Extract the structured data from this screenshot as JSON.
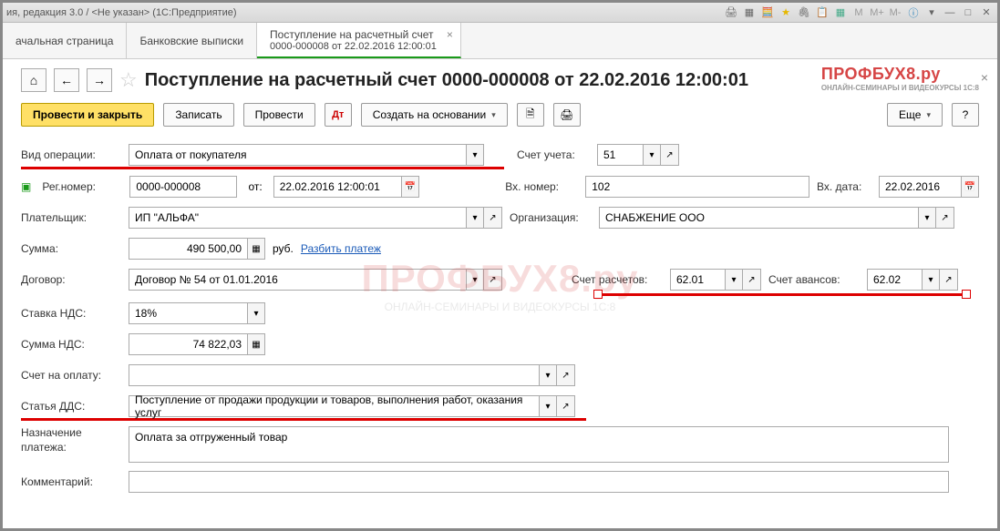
{
  "window": {
    "title": "ия, редакция 3.0 / <Не указан>  (1С:Предприятие)"
  },
  "tabs": {
    "items": [
      {
        "label": "ачальная страница"
      },
      {
        "label": "Банковские выписки"
      },
      {
        "label_line1": "Поступление на расчетный счет",
        "label_line2": "0000-000008 от 22.02.2016 12:00:01"
      }
    ]
  },
  "page": {
    "title": "Поступление на расчетный счет 0000-000008 от 22.02.2016 12:00:01"
  },
  "toolbar": {
    "submit_close": "Провести и закрыть",
    "save": "Записать",
    "submit": "Провести",
    "create_based": "Создать на основании",
    "more": "Еще",
    "help": "?"
  },
  "form": {
    "operation_label": "Вид операции:",
    "operation_value": "Оплата от покупателя",
    "account_label": "Счет учета:",
    "account_value": "51",
    "regnum_label": "Рег.номер:",
    "regnum_value": "0000-000008",
    "regnum_date_label": "от:",
    "regnum_date_value": "22.02.2016 12:00:01",
    "incoming_num_label": "Вх. номер:",
    "incoming_num_value": "102",
    "incoming_date_label": "Вх. дата:",
    "incoming_date_value": "22.02.2016",
    "payer_label": "Плательщик:",
    "payer_value": "ИП \"АЛЬФА\"",
    "org_label": "Организация:",
    "org_value": "СНАБЖЕНИЕ ООО",
    "sum_label": "Сумма:",
    "sum_value": "490 500,00",
    "sum_currency": "руб.",
    "split_link": "Разбить платеж",
    "contract_label": "Договор:",
    "contract_value": "Договор № 54 от 01.01.2016",
    "acc_settlements_label": "Счет расчетов:",
    "acc_settlements_value": "62.01",
    "acc_advances_label": "Счет авансов:",
    "acc_advances_value": "62.02",
    "vat_rate_label": "Ставка НДС:",
    "vat_rate_value": "18%",
    "vat_sum_label": "Сумма НДС:",
    "vat_sum_value": "74 822,03",
    "invoice_label": "Счет на оплату:",
    "invoice_value": "",
    "dds_label": "Статья ДДС:",
    "dds_value": "Поступление от продажи продукции и товаров, выполнения работ, оказания услуг",
    "purpose_label": "Назначение платежа:",
    "purpose_value": "Оплата за отгруженный товар",
    "comment_label": "Комментарий:",
    "comment_value": ""
  },
  "logo": {
    "main": "ПРОФБУХ8.ру",
    "sub": "ОНЛАЙН-СЕМИНАРЫ И ВИДЕОКУРСЫ 1С:8"
  }
}
